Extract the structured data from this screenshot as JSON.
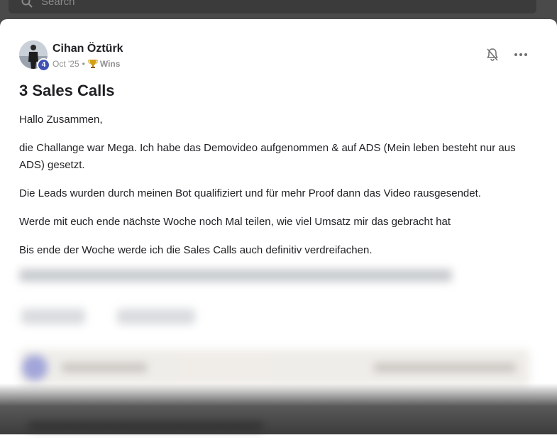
{
  "search": {
    "placeholder": "Search"
  },
  "post": {
    "author": {
      "name": "Cihan Öztürk",
      "level": "4"
    },
    "meta": {
      "date": "Oct '25",
      "separator": "•",
      "category": "Wins"
    },
    "title": "3 Sales Calls",
    "paragraphs": [
      "Hallo Zusammen,",
      "die Challange war Mega. Ich habe das Demovideo aufgenommen & auf ADS (Mein leben besteht nur aus ADS) gesetzt.",
      "Die Leads wurden durch meinen Bot qualifiziert und für mehr Proof dann das Video rausgesendet.",
      "Werde mit euch ende nächste Woche noch Mal teilen, wie viel Umsatz mir das gebracht hat",
      "Bis ende der Woche werde ich die Sales Calls auch definitiv verdreifachen."
    ]
  },
  "icons": {
    "search": "search-icon",
    "bell": "bell-off-icon",
    "more": "more-horizontal-icon",
    "trophy": "trophy-icon"
  },
  "colors": {
    "badge": "#3f51b5",
    "text": "#202124",
    "meta": "#909090"
  }
}
